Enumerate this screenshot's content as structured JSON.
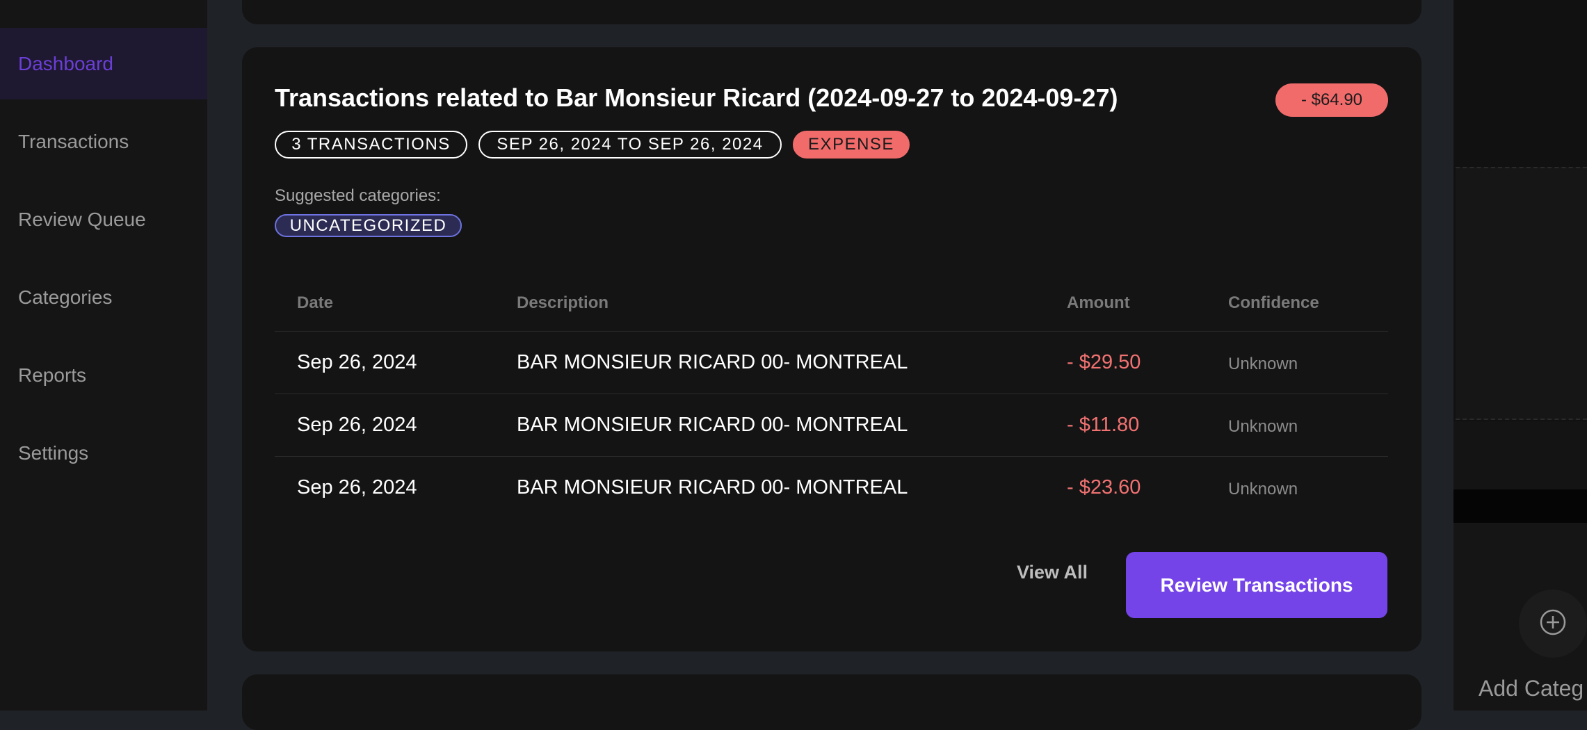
{
  "sidebar": {
    "items": [
      {
        "label": "Dashboard",
        "active": true
      },
      {
        "label": "Transactions",
        "active": false
      },
      {
        "label": "Review Queue",
        "active": false
      },
      {
        "label": "Categories",
        "active": false
      },
      {
        "label": "Reports",
        "active": false
      },
      {
        "label": "Settings",
        "active": false
      }
    ]
  },
  "card": {
    "title": "Transactions related to Bar Monsieur Ricard (2024-09-27 to 2024-09-27)",
    "total": "- $64.90",
    "chips": {
      "count": "3 TRANSACTIONS",
      "range": "SEP 26, 2024 TO SEP 26, 2024",
      "type": "EXPENSE"
    },
    "suggested_label": "Suggested categories:",
    "suggested_category": "UNCATEGORIZED",
    "table": {
      "headers": [
        "Date",
        "Description",
        "Amount",
        "Confidence"
      ],
      "rows": [
        {
          "date": "Sep 26, 2024",
          "description": "BAR MONSIEUR RICARD 00- MONTREAL",
          "amount": "- $29.50",
          "confidence": "Unknown"
        },
        {
          "date": "Sep 26, 2024",
          "description": "BAR MONSIEUR RICARD 00- MONTREAL",
          "amount": "- $11.80",
          "confidence": "Unknown"
        },
        {
          "date": "Sep 26, 2024",
          "description": "BAR MONSIEUR RICARD 00- MONTREAL",
          "amount": "- $23.60",
          "confidence": "Unknown"
        }
      ]
    },
    "view_all": "View All",
    "review_button": "Review Transactions"
  },
  "right_panel": {
    "add_label": "Add Categ",
    "add_icon": "plus-circle-icon"
  },
  "colors": {
    "accent": "#7444e8",
    "expense": "#f26b6b",
    "sidebar_active": "#6a3fd6"
  }
}
